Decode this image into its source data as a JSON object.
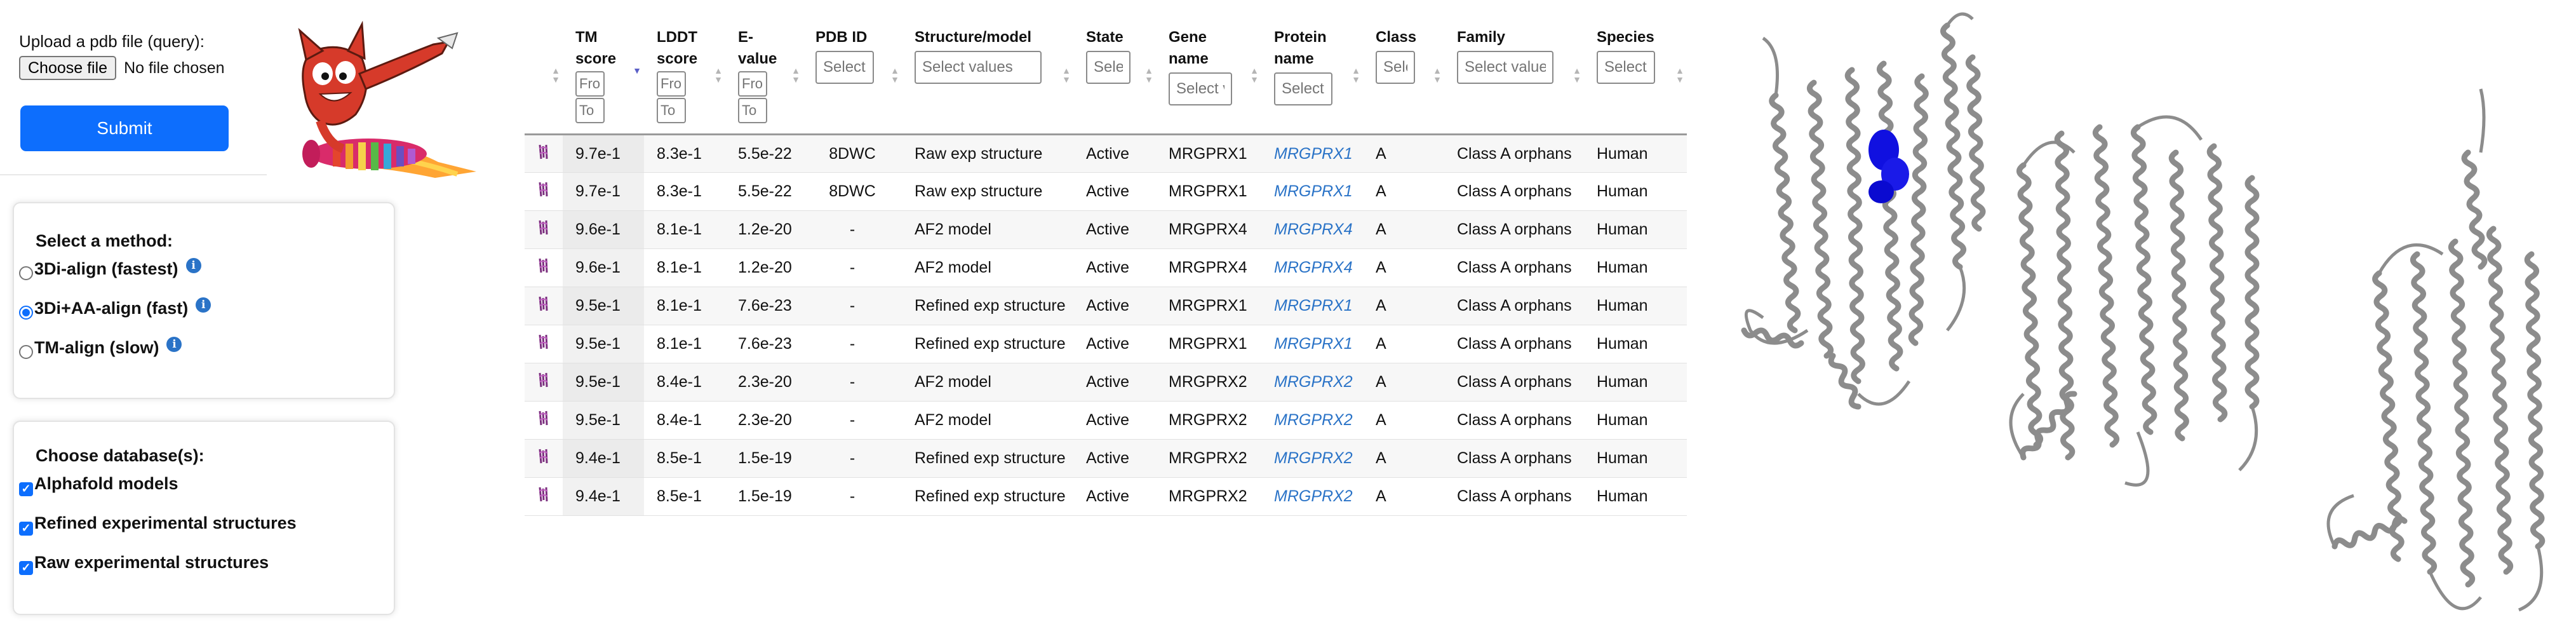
{
  "upload": {
    "label": "Upload a pdb file (query):",
    "choose_button": "Choose file",
    "file_status": "No file chosen",
    "submit_label": "Submit"
  },
  "method": {
    "title": "Select a method:",
    "options": [
      {
        "label": "3Di-align (fastest)",
        "selected": false
      },
      {
        "label": "3Di+AA-align (fast)",
        "selected": true
      },
      {
        "label": "TM-align (slow)",
        "selected": false
      }
    ]
  },
  "database": {
    "title": "Choose database(s):",
    "options": [
      {
        "label": "Alphafold models",
        "checked": true
      },
      {
        "label": "Refined experimental structures",
        "checked": true
      },
      {
        "label": "Raw experimental structures",
        "checked": true
      }
    ]
  },
  "table": {
    "headers": {
      "tm": "TM score",
      "lddt": "LDDT score",
      "evalue": "E-value",
      "pdb": "PDB ID",
      "structure": "Structure/model",
      "state": "State",
      "gene": "Gene name",
      "protein": "Protein name",
      "class": "Class",
      "family": "Family",
      "species": "Species"
    },
    "filters": {
      "from": "From",
      "to": "To",
      "select": "Select values"
    },
    "rows": [
      {
        "tm": "9.7e-1",
        "lddt": "8.3e-1",
        "evalue": "5.5e-22",
        "pdb": "8DWC",
        "structure": "Raw exp structure",
        "state": "Active",
        "gene": "MRGPRX1",
        "protein": "MRGPRX1",
        "class": "A",
        "family": "Class A orphans",
        "species": "Human"
      },
      {
        "tm": "9.7e-1",
        "lddt": "8.3e-1",
        "evalue": "5.5e-22",
        "pdb": "8DWC",
        "structure": "Raw exp structure",
        "state": "Active",
        "gene": "MRGPRX1",
        "protein": "MRGPRX1",
        "class": "A",
        "family": "Class A orphans",
        "species": "Human"
      },
      {
        "tm": "9.6e-1",
        "lddt": "8.1e-1",
        "evalue": "1.2e-20",
        "pdb": "-",
        "structure": "AF2 model",
        "state": "Active",
        "gene": "MRGPRX4",
        "protein": "MRGPRX4",
        "class": "A",
        "family": "Class A orphans",
        "species": "Human"
      },
      {
        "tm": "9.6e-1",
        "lddt": "8.1e-1",
        "evalue": "1.2e-20",
        "pdb": "-",
        "structure": "AF2 model",
        "state": "Active",
        "gene": "MRGPRX4",
        "protein": "MRGPRX4",
        "class": "A",
        "family": "Class A orphans",
        "species": "Human"
      },
      {
        "tm": "9.5e-1",
        "lddt": "8.1e-1",
        "evalue": "7.6e-23",
        "pdb": "-",
        "structure": "Refined exp structure",
        "state": "Active",
        "gene": "MRGPRX1",
        "protein": "MRGPRX1",
        "class": "A",
        "family": "Class A orphans",
        "species": "Human"
      },
      {
        "tm": "9.5e-1",
        "lddt": "8.1e-1",
        "evalue": "7.6e-23",
        "pdb": "-",
        "structure": "Refined exp structure",
        "state": "Active",
        "gene": "MRGPRX1",
        "protein": "MRGPRX1",
        "class": "A",
        "family": "Class A orphans",
        "species": "Human"
      },
      {
        "tm": "9.5e-1",
        "lddt": "8.4e-1",
        "evalue": "2.3e-20",
        "pdb": "-",
        "structure": "AF2 model",
        "state": "Active",
        "gene": "MRGPRX2",
        "protein": "MRGPRX2",
        "class": "A",
        "family": "Class A orphans",
        "species": "Human"
      },
      {
        "tm": "9.5e-1",
        "lddt": "8.4e-1",
        "evalue": "2.3e-20",
        "pdb": "-",
        "structure": "AF2 model",
        "state": "Active",
        "gene": "MRGPRX2",
        "protein": "MRGPRX2",
        "class": "A",
        "family": "Class A orphans",
        "species": "Human"
      },
      {
        "tm": "9.4e-1",
        "lddt": "8.5e-1",
        "evalue": "1.5e-19",
        "pdb": "-",
        "structure": "Refined exp structure",
        "state": "Active",
        "gene": "MRGPRX2",
        "protein": "MRGPRX2",
        "class": "A",
        "family": "Class A orphans",
        "species": "Human"
      },
      {
        "tm": "9.4e-1",
        "lddt": "8.5e-1",
        "evalue": "1.5e-19",
        "pdb": "-",
        "structure": "Refined exp structure",
        "state": "Active",
        "gene": "MRGPRX2",
        "protein": "MRGPRX2",
        "class": "A",
        "family": "Class A orphans",
        "species": "Human"
      }
    ]
  },
  "colors": {
    "accent": "#0d6efd",
    "link": "#2a73c7",
    "ribbon": "#8c8c8c",
    "ligand": "#1010e0"
  },
  "icons": {
    "row_icon": "gpcr-receptor-icon",
    "info_icon": "info-icon",
    "mascot": "rocket-cat-mascot"
  }
}
